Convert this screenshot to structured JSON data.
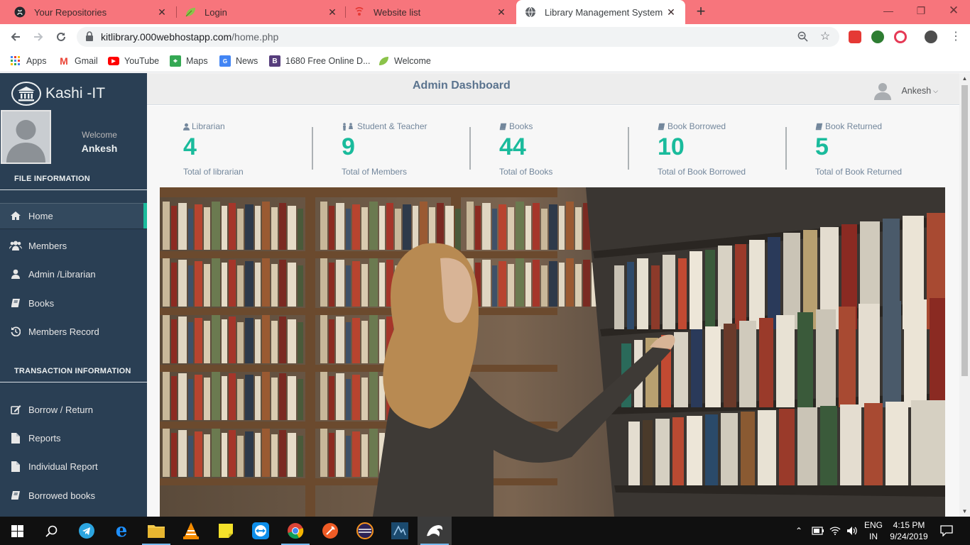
{
  "browser": {
    "tabs": [
      {
        "title": "Your Repositories",
        "icon": "github-icon"
      },
      {
        "title": "Login",
        "icon": "leaf-icon"
      },
      {
        "title": "Website list",
        "icon": "hosting-icon"
      },
      {
        "title": "Library Management System",
        "icon": "globe-icon"
      }
    ],
    "active_tab": 3,
    "url_domain": "kitlibrary.000webhostapp.com",
    "url_path": "/home.php",
    "bookmarks": [
      {
        "label": "Apps",
        "icon": "apps-grid-icon"
      },
      {
        "label": "Gmail",
        "icon": "gmail-icon"
      },
      {
        "label": "YouTube",
        "icon": "youtube-icon"
      },
      {
        "label": "Maps",
        "icon": "maps-icon"
      },
      {
        "label": "News",
        "icon": "news-icon"
      },
      {
        "label": "1680 Free Online D...",
        "icon": "bootstrap-icon"
      },
      {
        "label": "Welcome",
        "icon": "leaf-icon"
      }
    ]
  },
  "sidebar": {
    "brand": "Kashi -IT",
    "welcome": "Welcome",
    "username": "Ankesh",
    "sections": [
      {
        "title": "FILE INFORMATION",
        "items": [
          {
            "label": "Home",
            "icon": "home-icon",
            "active": true
          },
          {
            "label": "Members",
            "icon": "users-icon"
          },
          {
            "label": "Admin /Librarian",
            "icon": "user-icon"
          },
          {
            "label": "Books",
            "icon": "book-icon"
          },
          {
            "label": "Members Record",
            "icon": "history-icon"
          }
        ]
      },
      {
        "title": "TRANSACTION INFORMATION",
        "items": [
          {
            "label": "Borrow / Return",
            "icon": "edit-icon"
          },
          {
            "label": "Reports",
            "icon": "file-icon"
          },
          {
            "label": "Individual Report",
            "icon": "file-icon"
          },
          {
            "label": "Borrowed books",
            "icon": "book-icon"
          }
        ]
      }
    ]
  },
  "header": {
    "title": "Admin Dashboard",
    "user": "Ankesh"
  },
  "stats": [
    {
      "label": "Librarian",
      "count": "4",
      "sub": "Total of librarian",
      "icon": "user-icon"
    },
    {
      "label": "Student & Teacher",
      "count": "9",
      "sub": "Total of Members",
      "icon": "male-female-icon"
    },
    {
      "label": "Books",
      "count": "44",
      "sub": "Total of Books",
      "icon": "book-icon"
    },
    {
      "label": "Book Borrowed",
      "count": "10",
      "sub": "Total of Book Borrowed",
      "icon": "book-icon"
    },
    {
      "label": "Book Returned",
      "count": "5",
      "sub": "Total of Book Returned",
      "icon": "book-icon"
    }
  ],
  "taskbar": {
    "lang_top": "ENG",
    "lang_bottom": "IN",
    "time": "4:15 PM",
    "date": "9/24/2019"
  },
  "colors": {
    "tab_strip": "#f7757c",
    "sidebar": "#2a3f54",
    "accent": "#1abb9c",
    "title": "#5a738e"
  }
}
